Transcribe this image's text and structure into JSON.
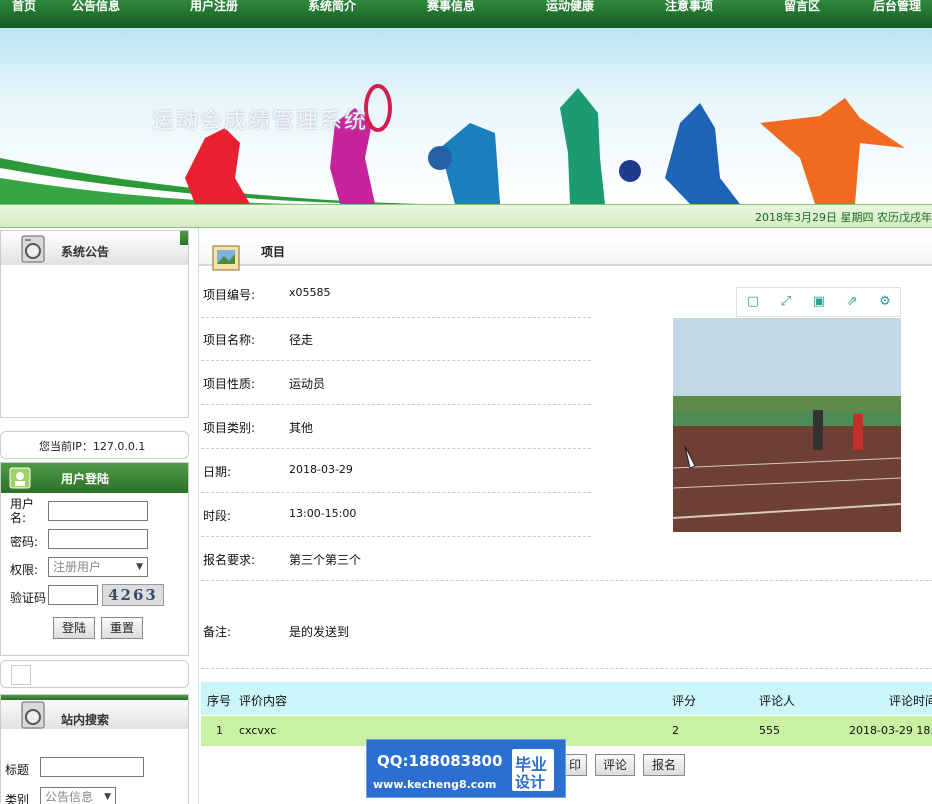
{
  "nav": [
    "首页",
    "公告信息",
    "用户注册",
    "系统简介",
    "赛事信息",
    "运动健康",
    "注意事项",
    "留言区",
    "后台管理"
  ],
  "banner": {
    "title": "运动会成绩管理系统"
  },
  "date_text": "2018年3月29日  星期四  农历戊戌年",
  "sidebar": {
    "notice_title": "系统公告",
    "ip_text": "您当前IP：127.0.0.1",
    "login": {
      "title": "用户登陆",
      "username_label": "用户名:",
      "password_label": "密码:",
      "role_label": "权限:",
      "role_value": "注册用户",
      "captcha_label": "验证码",
      "captcha_image_text": "4263",
      "login_button": "登陆",
      "reset_button": "重置"
    },
    "search": {
      "title": "站内搜索",
      "title_label": "标题",
      "category_label": "类别",
      "category_value": "公告信息"
    }
  },
  "main": {
    "title": "项目",
    "fields": [
      {
        "label": "项目编号:",
        "value": "x05585"
      },
      {
        "label": "项目名称:",
        "value": "径走"
      },
      {
        "label": "项目性质:",
        "value": "运动员"
      },
      {
        "label": "项目类别:",
        "value": "其他"
      },
      {
        "label": "日期:",
        "value": "2018-03-29"
      },
      {
        "label": "时段:",
        "value": "13:00-15:00"
      },
      {
        "label": "报名要求:",
        "value": "第三个第三个"
      },
      {
        "label": "备注:",
        "value": "是的发送到"
      }
    ],
    "table": {
      "headers": [
        "序号",
        "评价内容",
        "评分",
        "评论人",
        "评论时间"
      ],
      "rows": [
        [
          "1",
          "cxcvxc",
          "2",
          "555",
          "2018-03-29 18:"
        ]
      ]
    },
    "buttons": {
      "print": "印",
      "comment": "评论",
      "signup": "报名"
    }
  },
  "watermark": {
    "qq": "QQ:188083800",
    "url": "www.kecheng8.com",
    "tag1": "毕业",
    "tag2": "设计"
  },
  "colors": {
    "nav": "#1f6f2c",
    "accent_green": "#2b7229",
    "table_header": "#cbf6f9",
    "table_row": "#c8f2a2"
  }
}
